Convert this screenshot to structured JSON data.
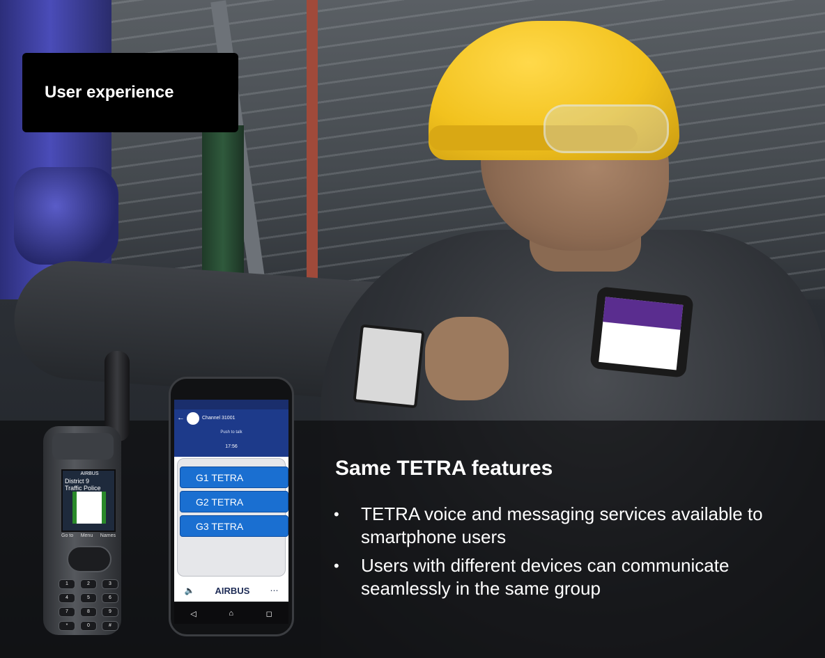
{
  "label": "User experience",
  "headline": "Same TETRA features",
  "bullets": [
    "TETRA voice and messaging services available to smartphone users",
    "Users with different devices can communicate seamlessly in the same group"
  ],
  "radio": {
    "brand": "AIRBUS",
    "screen_line1": "District 9",
    "screen_line2": "Traffic Police",
    "softkey_left": "Go to",
    "softkey_mid": "Menu",
    "softkey_right": "Names",
    "keys": [
      "1",
      "2",
      "3",
      "4",
      "5",
      "6",
      "7",
      "8",
      "9",
      "*",
      "0",
      "#"
    ]
  },
  "phone": {
    "channel": "Channel 31001",
    "ptt_text": "Push to talk",
    "time": "17:56",
    "groups": [
      "G1 TETRA",
      "G2 TETRA",
      "G3 TETRA"
    ],
    "brand": "AIRBUS",
    "speaker_icon": "speaker-icon",
    "more_icon": "more-icon"
  },
  "colors": {
    "label_bg": "#000000",
    "group_button": "#1a6fd1",
    "phone_header": "#1d3a8a",
    "helmet": "#f2c21e"
  }
}
